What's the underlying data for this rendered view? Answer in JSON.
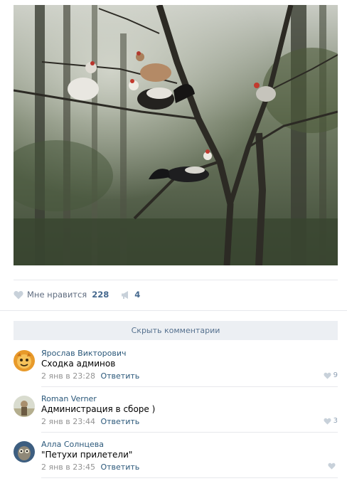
{
  "post": {
    "likes": {
      "label": "Мне нравится",
      "count": "228"
    },
    "shares": {
      "count": "4"
    }
  },
  "comments_toggle": {
    "label": "Скрыть комментарии"
  },
  "comments": [
    {
      "author": "Ярослав Викторович",
      "text": "Сходка админов",
      "date": "2 янв в 23:28",
      "reply": "Ответить",
      "likes": "9"
    },
    {
      "author": "Roman Verner",
      "text": "Администрация в сборе )",
      "date": "2 янв в 23:44",
      "reply": "Ответить",
      "likes": "3"
    },
    {
      "author": "Алла Солнцева",
      "text": "\"Петухи прилетели\"",
      "date": "2 янв в 23:45",
      "reply": "Ответить",
      "likes": ""
    }
  ],
  "colors": {
    "link": "#2b587a",
    "muted": "#939393",
    "accent": "#45688e",
    "panel": "#eceff3"
  },
  "icons": {
    "like": "heart-icon",
    "share": "megaphone-icon"
  }
}
